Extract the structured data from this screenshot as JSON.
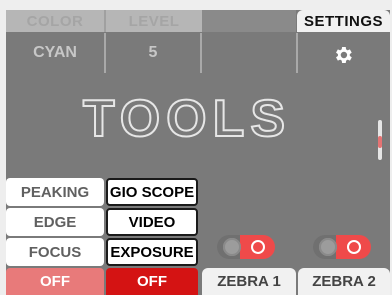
{
  "header": {
    "color_label": "COLOR",
    "level_label": "LEVEL",
    "settings_label": "SETTINGS"
  },
  "values": {
    "color_value": "CYAN",
    "level_value": "5"
  },
  "title": "TOOLS",
  "left_buttons": {
    "peaking": "PEAKING",
    "edge": "EDGE",
    "focus": "FOCUS",
    "focus_state": "OFF"
  },
  "mid_buttons": {
    "gio_scope": "GIO SCOPE",
    "video": "VIDEO",
    "exposure": "EXPOSURE",
    "exposure_state": "OFF"
  },
  "zebra": {
    "zebra1_label": "ZEBRA 1",
    "zebra2_label": "ZEBRA 2"
  },
  "icons": {
    "settings": "gear-icon"
  },
  "colors": {
    "accent_red": "#d41313",
    "soft_red": "#e87a7a",
    "toggle_red": "#ef4a4a"
  }
}
